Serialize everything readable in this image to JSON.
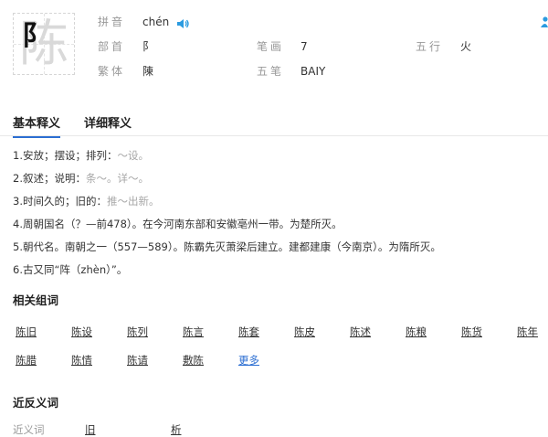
{
  "character": {
    "glyph": "陈",
    "stroke_glyph": "阝"
  },
  "info": {
    "pinyin_label": "拼音",
    "pinyin_value": "chén",
    "radical_label": "部首",
    "radical_value": "阝",
    "strokes_label": "笔画",
    "strokes_value": "7",
    "wuxing_label": "五行",
    "wuxing_value": "火",
    "traditional_label": "繁体",
    "traditional_value": "陳",
    "wubi_label": "五笔",
    "wubi_value": "BAIY"
  },
  "tabs": [
    {
      "label": "基本释义"
    },
    {
      "label": "详细释义"
    }
  ],
  "definitions": [
    {
      "text": "1.安放；摆设；排列：",
      "example": "～设。"
    },
    {
      "text": "2.叙述；说明：",
      "example": "条～。详～。"
    },
    {
      "text": "3.时间久的；旧的：",
      "example": "推～出新。"
    },
    {
      "text": "4.周朝国名（？—前478）。在今河南东部和安徽亳州一带。为楚所灭。",
      "example": ""
    },
    {
      "text": "5.朝代名。南朝之一（557—589）。陈霸先灭萧梁后建立。建都建康（今南京）。为隋所灭。",
      "example": ""
    },
    {
      "text": "6.古又同“阵（zhèn）”。",
      "example": ""
    }
  ],
  "related": {
    "title": "相关组词",
    "row1": [
      "陈旧",
      "陈设",
      "陈列",
      "陈言",
      "陈套",
      "陈皮",
      "陈述",
      "陈粮",
      "陈货",
      "陈年"
    ],
    "row2": [
      "陈腊",
      "陈情",
      "陈请",
      "敷陈",
      "更多"
    ]
  },
  "synonyms": {
    "title": "近反义词",
    "row_label": "近义词",
    "row_values": [
      "旧",
      "析"
    ]
  },
  "colors": {
    "link": "#2b6ed2",
    "example": "#a7a7a7",
    "label": "#999999",
    "speaker": "#2b9be0"
  },
  "icons": [
    "speaker-icon",
    "user-icon"
  ]
}
